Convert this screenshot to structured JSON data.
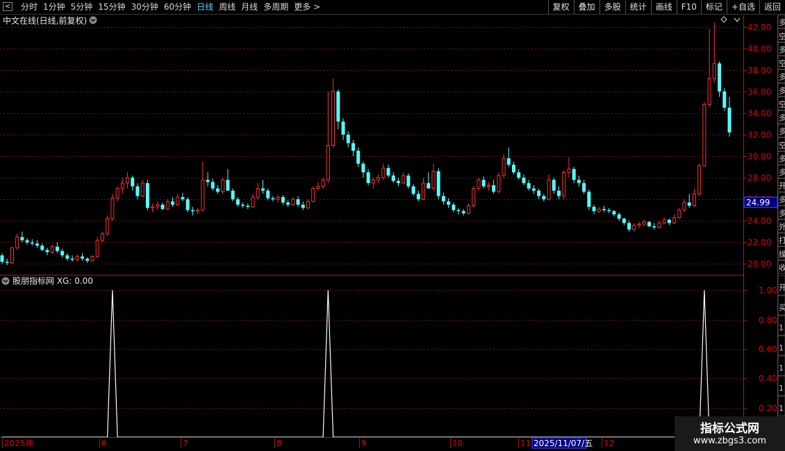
{
  "toolbar": {
    "periods": [
      "分时",
      "1分钟",
      "5分钟",
      "15分钟",
      "30分钟",
      "60分钟",
      "日线",
      "周线",
      "月线",
      "多周期",
      "更多 >"
    ],
    "active_period_index": 6,
    "tools": [
      "复权",
      "叠加",
      "多股",
      "统计",
      "画线",
      "F10",
      "标记",
      "+自选",
      "返回"
    ]
  },
  "main_panel": {
    "title": "中文在线(日线,前复权)",
    "price_tag": "24.99",
    "right_tabs": [
      "多",
      "空",
      "多",
      "空",
      "多",
      "多",
      "空",
      "多",
      "多",
      "空",
      "多",
      "多",
      "开",
      "多",
      "多",
      "外",
      "打",
      "操",
      "收"
    ]
  },
  "indicator_panel": {
    "title": "股朋指标网 XG: 0.00",
    "right_tabs": [
      "开",
      "买",
      "1",
      "1",
      "1",
      "1",
      "1"
    ]
  },
  "time_axis": {
    "labels": [
      "2025年",
      "6",
      "7",
      "8",
      "9",
      "10",
      "11",
      "12"
    ],
    "cursor_label": "2025/11/07/五"
  },
  "watermark": {
    "title": "指标公式网",
    "url": "www.zbgs3.com"
  },
  "colors": {
    "up": "#ff3232",
    "down": "#54ffff",
    "grid": "#6e1414",
    "axis": "#9a1a1a",
    "active": "#5ad6ff"
  },
  "chart_data": [
    {
      "type": "candlestick",
      "price_ticks": [
        42.0,
        40.0,
        38.0,
        36.0,
        34.0,
        32.0,
        30.0,
        28.0,
        26.0,
        24.0,
        22.0,
        20.0
      ],
      "ylim": [
        19.0,
        43.0
      ],
      "last_price": 24.99,
      "ohlc": [
        [
          20.8,
          21.0,
          20.0,
          20.2
        ],
        [
          20.2,
          20.5,
          19.9,
          20.1
        ],
        [
          20.1,
          21.6,
          20.0,
          21.5
        ],
        [
          21.5,
          22.8,
          21.3,
          22.5
        ],
        [
          22.5,
          23.0,
          22.0,
          22.2
        ],
        [
          22.2,
          22.4,
          21.8,
          22.0
        ],
        [
          22.0,
          22.3,
          21.7,
          21.9
        ],
        [
          21.9,
          22.2,
          21.5,
          21.7
        ],
        [
          21.7,
          21.9,
          21.2,
          21.3
        ],
        [
          21.3,
          21.5,
          20.8,
          21.1
        ],
        [
          21.1,
          21.8,
          20.9,
          21.6
        ],
        [
          21.6,
          22.0,
          21.0,
          21.2
        ],
        [
          21.2,
          21.4,
          20.6,
          20.8
        ],
        [
          20.8,
          21.0,
          20.3,
          20.5
        ],
        [
          20.5,
          20.8,
          20.2,
          20.4
        ],
        [
          20.4,
          20.9,
          20.2,
          20.7
        ],
        [
          20.7,
          21.0,
          20.3,
          20.5
        ],
        [
          20.5,
          20.6,
          20.1,
          20.3
        ],
        [
          20.3,
          20.8,
          20.2,
          20.7
        ],
        [
          20.7,
          22.5,
          20.6,
          22.2
        ],
        [
          22.2,
          23.0,
          22.0,
          22.8
        ],
        [
          22.8,
          24.5,
          22.6,
          24.2
        ],
        [
          24.2,
          26.5,
          24.0,
          26.1
        ],
        [
          26.1,
          27.2,
          25.8,
          27.0
        ],
        [
          27.0,
          28.0,
          26.5,
          27.5
        ],
        [
          27.5,
          28.5,
          27.0,
          28.0
        ],
        [
          28.0,
          28.2,
          26.8,
          27.2
        ],
        [
          27.2,
          27.5,
          26.0,
          26.3
        ],
        [
          26.3,
          27.8,
          26.2,
          27.5
        ],
        [
          27.5,
          27.8,
          25.0,
          25.2
        ],
        [
          25.2,
          25.6,
          24.8,
          25.3
        ],
        [
          25.3,
          25.8,
          25.0,
          25.5
        ],
        [
          25.5,
          25.7,
          25.0,
          25.1
        ],
        [
          25.1,
          26.0,
          25.0,
          25.8
        ],
        [
          25.8,
          26.2,
          25.3,
          25.5
        ],
        [
          25.5,
          26.5,
          25.4,
          26.2
        ],
        [
          26.2,
          26.6,
          25.8,
          26.0
        ],
        [
          26.0,
          26.2,
          24.8,
          25.0
        ],
        [
          25.0,
          25.3,
          24.5,
          24.9
        ],
        [
          24.9,
          25.2,
          24.6,
          25.0
        ],
        [
          25.0,
          29.5,
          24.9,
          27.8
        ],
        [
          27.8,
          28.5,
          27.2,
          27.6
        ],
        [
          27.6,
          27.9,
          26.8,
          27.0
        ],
        [
          27.0,
          27.3,
          26.5,
          26.7
        ],
        [
          26.7,
          28.0,
          26.5,
          27.8
        ],
        [
          27.8,
          28.8,
          27.5,
          26.8
        ],
        [
          26.8,
          27.0,
          25.8,
          26.0
        ],
        [
          26.0,
          26.2,
          25.3,
          25.5
        ],
        [
          25.5,
          25.7,
          25.2,
          25.4
        ],
        [
          25.4,
          25.6,
          25.1,
          25.3
        ],
        [
          25.3,
          26.5,
          25.2,
          26.2
        ],
        [
          26.2,
          27.5,
          26.0,
          27.0
        ],
        [
          27.0,
          27.8,
          26.5,
          26.8
        ],
        [
          26.8,
          27.0,
          25.9,
          26.1
        ],
        [
          26.1,
          26.3,
          25.8,
          26.0
        ],
        [
          26.0,
          26.4,
          25.7,
          26.2
        ],
        [
          26.2,
          26.4,
          25.5,
          25.7
        ],
        [
          25.7,
          25.9,
          25.3,
          25.5
        ],
        [
          25.5,
          26.2,
          25.4,
          26.0
        ],
        [
          26.0,
          26.3,
          25.3,
          25.5
        ],
        [
          25.5,
          25.8,
          25.0,
          25.2
        ],
        [
          25.2,
          26.0,
          25.1,
          25.8
        ],
        [
          25.8,
          27.2,
          25.7,
          27.0
        ],
        [
          27.0,
          27.6,
          26.8,
          27.2
        ],
        [
          27.2,
          28.0,
          27.0,
          27.8
        ],
        [
          27.8,
          36.0,
          27.5,
          31.0
        ],
        [
          31.0,
          37.2,
          30.8,
          36.0
        ],
        [
          36.0,
          36.2,
          32.5,
          33.2
        ],
        [
          33.2,
          33.5,
          31.5,
          32.0
        ],
        [
          32.0,
          32.3,
          30.8,
          31.2
        ],
        [
          31.2,
          31.5,
          30.0,
          30.5
        ],
        [
          30.5,
          30.8,
          29.0,
          29.3
        ],
        [
          29.3,
          29.5,
          28.0,
          28.5
        ],
        [
          28.5,
          28.8,
          27.3,
          27.5
        ],
        [
          27.5,
          28.0,
          27.0,
          27.8
        ],
        [
          27.8,
          28.3,
          27.5,
          28.0
        ],
        [
          28.0,
          29.3,
          27.8,
          28.9
        ],
        [
          28.9,
          29.2,
          28.0,
          28.2
        ],
        [
          28.2,
          28.5,
          27.5,
          27.7
        ],
        [
          27.7,
          28.0,
          27.2,
          27.5
        ],
        [
          27.5,
          28.5,
          27.4,
          28.2
        ],
        [
          28.2,
          28.4,
          27.0,
          27.2
        ],
        [
          27.2,
          27.4,
          26.3,
          26.5
        ],
        [
          26.5,
          26.8,
          25.8,
          26.0
        ],
        [
          26.0,
          28.0,
          25.9,
          27.5
        ],
        [
          27.5,
          28.5,
          27.2,
          27.0
        ],
        [
          27.0,
          29.3,
          26.8,
          28.6
        ],
        [
          28.6,
          28.9,
          26.0,
          26.3
        ],
        [
          26.3,
          26.6,
          25.5,
          25.8
        ],
        [
          25.8,
          26.1,
          25.2,
          25.5
        ],
        [
          25.5,
          25.7,
          24.8,
          25.0
        ],
        [
          25.0,
          25.2,
          24.6,
          24.9
        ],
        [
          24.9,
          25.1,
          24.5,
          24.7
        ],
        [
          24.7,
          25.6,
          24.6,
          25.4
        ],
        [
          25.4,
          27.2,
          25.2,
          27.0
        ],
        [
          27.0,
          28.0,
          26.8,
          27.8
        ],
        [
          27.8,
          28.1,
          27.0,
          27.2
        ],
        [
          27.2,
          27.6,
          26.8,
          27.3
        ],
        [
          27.3,
          27.8,
          26.5,
          26.7
        ],
        [
          26.7,
          28.5,
          26.6,
          28.2
        ],
        [
          28.2,
          30.2,
          28.0,
          29.8
        ],
        [
          29.8,
          30.8,
          29.0,
          29.2
        ],
        [
          29.2,
          29.5,
          28.3,
          28.5
        ],
        [
          28.5,
          28.8,
          27.8,
          28.0
        ],
        [
          28.0,
          28.3,
          27.3,
          27.5
        ],
        [
          27.5,
          27.8,
          26.8,
          27.0
        ],
        [
          27.0,
          27.3,
          26.5,
          26.8
        ],
        [
          26.8,
          27.0,
          26.0,
          26.3
        ],
        [
          26.3,
          26.5,
          25.8,
          26.0
        ],
        [
          26.0,
          28.3,
          25.9,
          27.8
        ],
        [
          27.8,
          28.0,
          26.5,
          26.8
        ],
        [
          26.8,
          27.2,
          26.0,
          26.3
        ],
        [
          26.3,
          28.7,
          26.0,
          28.5
        ],
        [
          28.5,
          29.9,
          28.0,
          28.8
        ],
        [
          28.8,
          29.0,
          27.5,
          27.8
        ],
        [
          27.8,
          28.2,
          27.2,
          27.5
        ],
        [
          27.5,
          27.8,
          26.5,
          26.7
        ],
        [
          26.7,
          26.9,
          25.0,
          25.3
        ],
        [
          25.3,
          25.5,
          24.6,
          24.9
        ],
        [
          24.9,
          25.3,
          24.7,
          25.1
        ],
        [
          25.1,
          25.4,
          24.8,
          25.0
        ],
        [
          25.0,
          25.2,
          24.7,
          24.9
        ],
        [
          24.9,
          25.0,
          24.4,
          24.6
        ],
        [
          24.6,
          24.8,
          24.0,
          24.2
        ],
        [
          24.2,
          24.3,
          23.6,
          23.8
        ],
        [
          23.8,
          24.0,
          23.0,
          23.2
        ],
        [
          23.2,
          23.8,
          23.0,
          23.6
        ],
        [
          23.6,
          23.9,
          23.3,
          23.7
        ],
        [
          23.7,
          24.1,
          23.5,
          23.9
        ],
        [
          23.9,
          24.0,
          23.4,
          23.5
        ],
        [
          23.5,
          23.8,
          23.2,
          23.4
        ],
        [
          23.4,
          24.0,
          23.3,
          23.8
        ],
        [
          23.8,
          24.3,
          23.7,
          24.1
        ],
        [
          24.1,
          24.2,
          23.6,
          23.8
        ],
        [
          23.8,
          24.6,
          23.7,
          24.3
        ],
        [
          24.3,
          25.2,
          24.2,
          25.0
        ],
        [
          25.0,
          26.0,
          24.8,
          25.7
        ],
        [
          25.7,
          26.5,
          25.2,
          25.4
        ],
        [
          25.4,
          27.0,
          25.3,
          26.5
        ],
        [
          26.5,
          29.3,
          26.3,
          29.1
        ],
        [
          29.1,
          35.0,
          29.0,
          34.8
        ],
        [
          34.8,
          41.8,
          34.5,
          37.2
        ],
        [
          37.2,
          42.4,
          36.8,
          38.6
        ],
        [
          38.6,
          38.8,
          35.5,
          36.0
        ],
        [
          36.0,
          36.3,
          34.2,
          34.5
        ],
        [
          34.5,
          35.5,
          31.8,
          32.2
        ]
      ]
    },
    {
      "type": "line",
      "name": "XG",
      "ylim": [
        0,
        1.1
      ],
      "y_ticks": [
        1.0,
        0.8,
        0.6,
        0.4,
        0.2
      ],
      "signal_bars": [
        22,
        65,
        140
      ]
    }
  ]
}
